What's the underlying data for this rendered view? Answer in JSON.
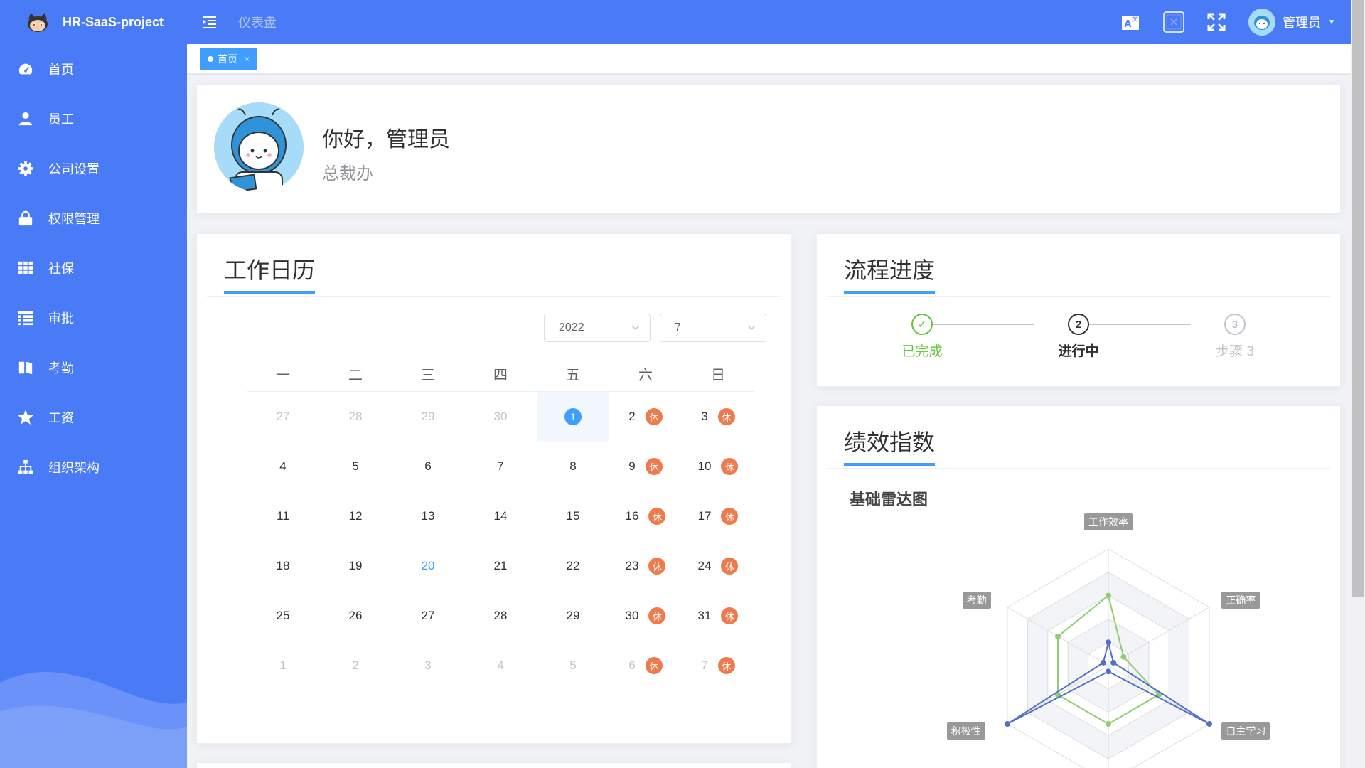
{
  "app": {
    "title": "HR-SaaS-project",
    "logo_icon": "github-cat-icon"
  },
  "sidebar": {
    "items": [
      {
        "label": "首页",
        "icon": "dashboard-icon"
      },
      {
        "label": "员工",
        "icon": "user-icon"
      },
      {
        "label": "公司设置",
        "icon": "gear-icon"
      },
      {
        "label": "权限管理",
        "icon": "lock-icon"
      },
      {
        "label": "社保",
        "icon": "table-icon"
      },
      {
        "label": "审批",
        "icon": "tree-table-icon"
      },
      {
        "label": "考勤",
        "icon": "book-icon"
      },
      {
        "label": "工资",
        "icon": "star-icon"
      },
      {
        "label": "组织架构",
        "icon": "org-tree-icon"
      }
    ]
  },
  "header": {
    "breadcrumb": "仪表盘",
    "user_name": "管理员",
    "icons": [
      "translate-icon",
      "theme-picker-icon",
      "fullscreen-icon"
    ]
  },
  "tags": [
    {
      "label": "首页",
      "close": "×"
    }
  ],
  "welcome": {
    "greeting": "你好，管理员",
    "department": "总裁办"
  },
  "calendar": {
    "title": "工作日历",
    "year": "2022",
    "month": "7",
    "weekdays": [
      "一",
      "二",
      "三",
      "四",
      "五",
      "六",
      "日"
    ],
    "rest_label": "休",
    "weeks": [
      [
        {
          "d": "27",
          "o": true
        },
        {
          "d": "28",
          "o": true
        },
        {
          "d": "29",
          "o": true
        },
        {
          "d": "30",
          "o": true
        },
        {
          "d": "1",
          "sel": true
        },
        {
          "d": "2",
          "r": true
        },
        {
          "d": "3",
          "r": true
        }
      ],
      [
        {
          "d": "4"
        },
        {
          "d": "5"
        },
        {
          "d": "6"
        },
        {
          "d": "7"
        },
        {
          "d": "8"
        },
        {
          "d": "9",
          "r": true
        },
        {
          "d": "10",
          "r": true
        }
      ],
      [
        {
          "d": "11"
        },
        {
          "d": "12"
        },
        {
          "d": "13"
        },
        {
          "d": "14"
        },
        {
          "d": "15"
        },
        {
          "d": "16",
          "r": true
        },
        {
          "d": "17",
          "r": true
        }
      ],
      [
        {
          "d": "18"
        },
        {
          "d": "19"
        },
        {
          "d": "20",
          "t": true
        },
        {
          "d": "21"
        },
        {
          "d": "22"
        },
        {
          "d": "23",
          "r": true
        },
        {
          "d": "24",
          "r": true
        }
      ],
      [
        {
          "d": "25"
        },
        {
          "d": "26"
        },
        {
          "d": "27"
        },
        {
          "d": "28"
        },
        {
          "d": "29"
        },
        {
          "d": "30",
          "r": true
        },
        {
          "d": "31",
          "r": true
        }
      ],
      [
        {
          "d": "1",
          "o": true
        },
        {
          "d": "2",
          "o": true
        },
        {
          "d": "3",
          "o": true
        },
        {
          "d": "4",
          "o": true
        },
        {
          "d": "5",
          "o": true
        },
        {
          "d": "6",
          "o": true,
          "r": true
        },
        {
          "d": "7",
          "o": true,
          "r": true
        }
      ]
    ]
  },
  "process": {
    "title": "流程进度",
    "steps": [
      {
        "label": "已完成",
        "mark": "✓",
        "status": "success"
      },
      {
        "label": "进行中",
        "mark": "2",
        "status": "process"
      },
      {
        "label": "步骤 3",
        "mark": "3",
        "status": "wait"
      }
    ]
  },
  "performance": {
    "title": "绩效指数",
    "radar_title": "基础雷达图",
    "axes": [
      "工作效率",
      "正确率",
      "自主学习",
      "工作效率",
      "积极性",
      "考勤"
    ],
    "axes_visible": [
      "工作效率",
      "正确率",
      "自主学习",
      "积极性",
      "考勤"
    ],
    "series": [
      {
        "name": "green",
        "color": "#91cc75",
        "values": [
          0.6,
          0.15,
          0.5,
          0.5,
          0.5,
          0.5
        ]
      },
      {
        "name": "blue",
        "color": "#5470c6",
        "values": [
          0.2,
          0.05,
          1.0,
          0.05,
          1.0,
          0.05
        ]
      }
    ]
  },
  "colors": {
    "primary": "#409eff",
    "sidebar": "#4a7bf7",
    "rest": "#ef7b4c",
    "success": "#67c23a"
  }
}
